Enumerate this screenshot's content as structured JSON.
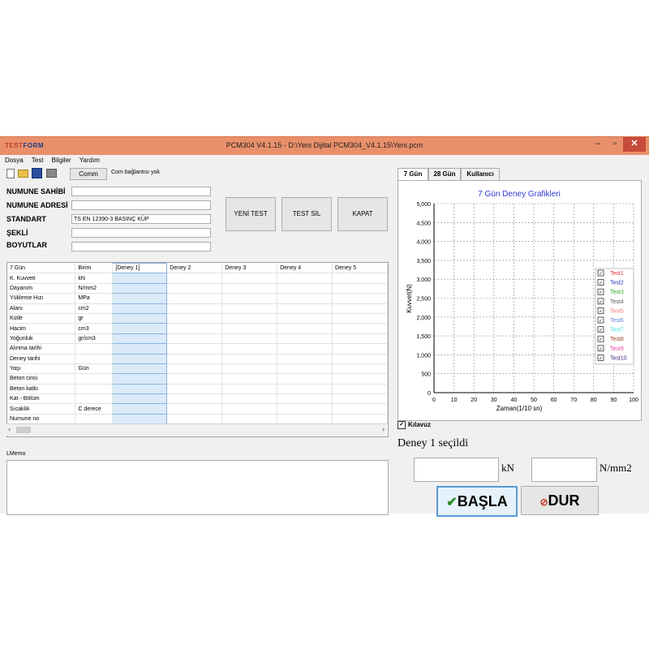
{
  "window": {
    "logo": "TESTFORM",
    "title": "PCM304 V4.1.15  -  D:\\Yeni Dijital PCM304_V4.1.15\\Yeni.pcm",
    "min": "–",
    "max": "▫",
    "close": "✕"
  },
  "menu": [
    "Dosya",
    "Test",
    "Bilgiler",
    "Yardım"
  ],
  "toolbar": {
    "comm_label": "Comm",
    "com_status": "Com bağlantısı yok"
  },
  "fields": [
    {
      "label": "NUMUNE SAHİBİ",
      "value": ""
    },
    {
      "label": "NUMUNE ADRESİ",
      "value": ""
    },
    {
      "label": "STANDART",
      "value": "TS EN 12390-3 BASINÇ KÜP"
    },
    {
      "label": "ŞEKLİ",
      "value": ""
    },
    {
      "label": "BOYUTLAR",
      "value": ""
    }
  ],
  "buttons": {
    "new_test": "YENİ TEST",
    "delete_test": "TEST SİL",
    "close": "KAPAT"
  },
  "grid": {
    "headers": [
      "7 Gün",
      "Birim",
      "[Deney 1]",
      "Deney 2",
      "Deney 3",
      "Deney 4",
      "Deney 5"
    ],
    "rows": [
      [
        "K. Kuvveti",
        "kN"
      ],
      [
        "Dayanım",
        "N/mm2"
      ],
      [
        "Yükleme Hızı",
        "MPa"
      ],
      [
        "Alanı",
        "cm2"
      ],
      [
        "Kütle",
        "gr"
      ],
      [
        "Hacim",
        "cm3"
      ],
      [
        "Yoğunluk",
        "gr/cm3"
      ],
      [
        "Alınma tarihi",
        ""
      ],
      [
        "Deney tarihi",
        ""
      ],
      [
        "Yaşı",
        "Gün"
      ],
      [
        "Beton cinsi",
        ""
      ],
      [
        "Beton katkı",
        ""
      ],
      [
        "Kat - Bölüm",
        ""
      ],
      [
        "Sıcaklık",
        "C derece"
      ],
      [
        "Numune no",
        ""
      ]
    ]
  },
  "memo_label": "LMemo",
  "tabs": [
    "7 Gün",
    "28 Gün",
    "Kullanıcı"
  ],
  "chart_data": {
    "type": "line",
    "title": "7 Gün Deney Grafikleri",
    "xlabel": "Zaman(1/10 sn)",
    "ylabel": "Kuvvet(N)",
    "xlim": [
      0,
      100
    ],
    "ylim": [
      0,
      5000
    ],
    "xticks": [
      "0",
      "10",
      "20",
      "30",
      "40",
      "50",
      "60",
      "70",
      "80",
      "90",
      "100"
    ],
    "yticks": [
      "0",
      "500",
      "1,000",
      "1,500",
      "2,000",
      "2,500",
      "3,000",
      "3,500",
      "4,000",
      "4,500",
      "5,000"
    ],
    "grid": true,
    "legend_position": "right",
    "series": [
      {
        "name": "Test1",
        "color": "#e03030",
        "values": []
      },
      {
        "name": "Test2",
        "color": "#2030c0",
        "values": []
      },
      {
        "name": "Test3",
        "color": "#30b030",
        "values": []
      },
      {
        "name": "Test4",
        "color": "#606060",
        "values": []
      },
      {
        "name": "Test5",
        "color": "#f07070",
        "values": []
      },
      {
        "name": "Test6",
        "color": "#6080e0",
        "values": []
      },
      {
        "name": "Test7",
        "color": "#40e0e0",
        "values": []
      },
      {
        "name": "Test8",
        "color": "#a04020",
        "values": []
      },
      {
        "name": "Test9",
        "color": "#e040a0",
        "values": []
      },
      {
        "name": "Test10",
        "color": "#402070",
        "values": []
      }
    ]
  },
  "guide_label": "Kılavuz",
  "selected_text": "Deney 1 seçildi",
  "units": {
    "force": "kN",
    "stress": "N/mm2"
  },
  "actions": {
    "start": "BAŞLA",
    "stop": "DUR"
  },
  "colors": {
    "titlebar": "#e9906a",
    "accent": "#5b9bd5"
  }
}
